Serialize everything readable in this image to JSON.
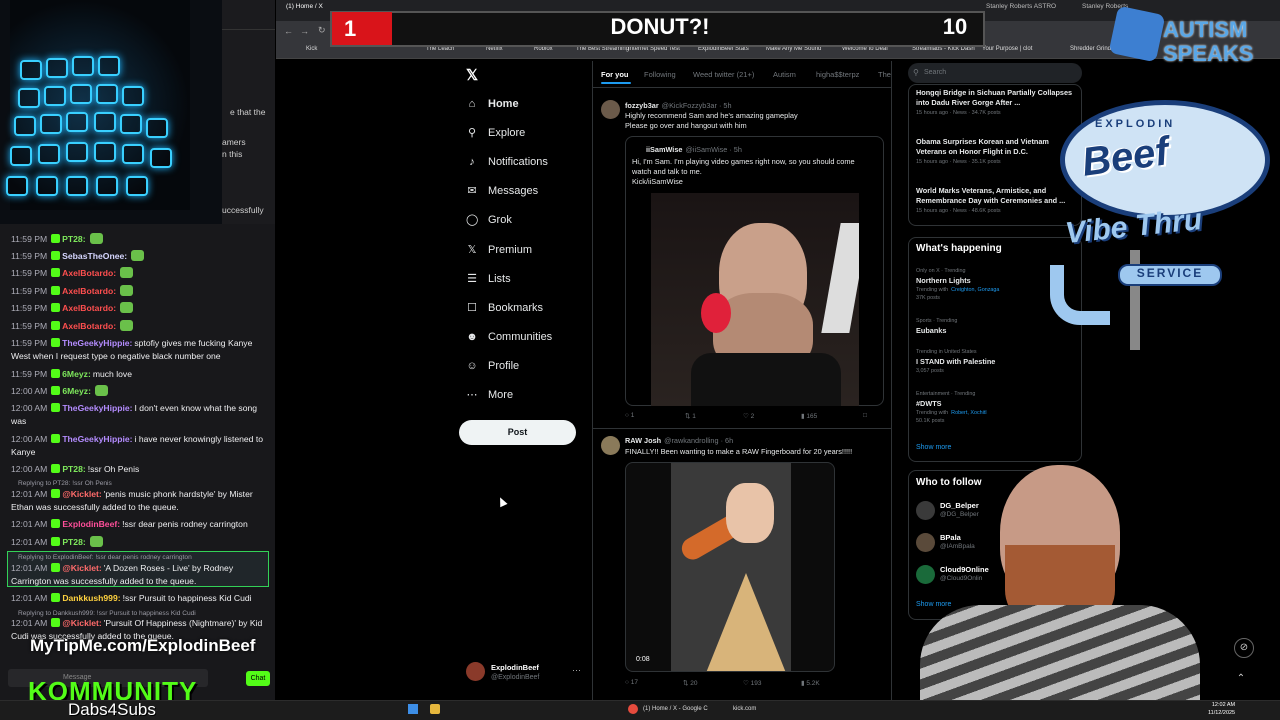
{
  "overlay": {
    "donut_left": "1",
    "donut_title": "DONUT?!",
    "donut_right": "10",
    "autism_line1": "AUTISM",
    "autism_line2": "SPEAKS",
    "beef_top": "EXPLODIN",
    "beef_name": "Beef",
    "vibe": "Vibe Thru",
    "service": "SERVICE",
    "tip_url": "MyTipMe.com/ExplodinBeef",
    "community": "KOMMUNITY",
    "dabs": "Dabs4Subs"
  },
  "chat_top_snippets": [
    "e that the",
    "amers",
    "n this",
    "uccessfully"
  ],
  "chat": [
    {
      "time": "11:59 PM",
      "user": "PT28:",
      "color": "#7ee85c",
      "text": ""
    },
    {
      "time": "11:59 PM",
      "user": "SebasTheOnee:",
      "color": "#d6d6ff",
      "text": ""
    },
    {
      "time": "11:59 PM",
      "user": "AxelBotardo:",
      "color": "#ff4f4f",
      "text": ""
    },
    {
      "time": "11:59 PM",
      "user": "AxelBotardo:",
      "color": "#ff4f4f",
      "text": ""
    },
    {
      "time": "11:59 PM",
      "user": "AxelBotardo:",
      "color": "#ff4f4f",
      "text": ""
    },
    {
      "time": "11:59 PM",
      "user": "AxelBotardo:",
      "color": "#ff4f4f",
      "text": ""
    },
    {
      "time": "11:59 PM",
      "user": "TheGeekyHippie:",
      "color": "#b48cff",
      "text": "sptofiy gives me fucking Kanye West when I request type o negative black number one"
    },
    {
      "time": "11:59 PM",
      "user": "6Meyz:",
      "color": "#7ee85c",
      "text": "much love"
    },
    {
      "time": "12:00 AM",
      "user": "6Meyz:",
      "color": "#7ee85c",
      "text": ""
    },
    {
      "time": "12:00 AM",
      "user": "TheGeekyHippie:",
      "color": "#b48cff",
      "text": "I don't even know what the song was"
    },
    {
      "time": "12:00 AM",
      "user": "TheGeekyHippie:",
      "color": "#b48cff",
      "text": "i have never knowingly listened to Kanye"
    },
    {
      "time": "12:00 AM",
      "user": "PT28:",
      "color": "#7ee85c",
      "text": "!ssr Oh Penis"
    },
    {
      "time": "12:01 AM",
      "user": "@Kicklet:",
      "color": "#ff6b6b",
      "text": "'penis music phonk hardstyle' by Mister Ethan was successfully added to the queue."
    },
    {
      "time": "12:01 AM",
      "user": "ExplodinBeef:",
      "color": "#ff4f9a",
      "text": "!ssr dear penis rodney carrington"
    },
    {
      "time": "12:01 AM",
      "user": "PT28:",
      "color": "#7ee85c",
      "text": ""
    },
    {
      "time": "12:01 AM",
      "user": "@Kicklet:",
      "color": "#ff6b6b",
      "text": "'A Dozen Roses - Live' by Rodney Carrington was successfully added to the queue."
    },
    {
      "time": "12:01 AM",
      "user": "Dankkush999:",
      "color": "#ffd23f",
      "text": "!ssr Pursuit to happiness Kid Cudi"
    },
    {
      "time": "12:01 AM",
      "user": "@Kicklet:",
      "color": "#ff6b6b",
      "text": "'Pursuit Of Happiness (Nightmare)' by Kid Cudi was successfully added to the queue."
    }
  ],
  "replies": [
    "Replying to PT28: !ssr Oh Penis",
    "Replying to ExplodinBeef: !ssr dear penis rodney carrington",
    "Replying to Dankkush999: !ssr Pursuit to happiness Kid Cudi"
  ],
  "chat_input": {
    "placeholder": "Message",
    "send": "Chat"
  },
  "tabs": [
    "(1) Home / X",
    "Kick",
    "Stanley Roberts ASTRO",
    "Stanley Roberts"
  ],
  "bookmarks": [
    "Kick",
    "Twitch",
    "The Leach",
    "Netflix",
    "Roblox",
    "The Best Streaming",
    "Internet Speed Test",
    "ExplodinBeef Stats",
    "Make Any Me Sound",
    "Welcome to Deaf",
    "Streamlabs - Kick Dash",
    "Your Purpose | clot",
    "Shredder Grinder"
  ],
  "x": {
    "nav": [
      "Home",
      "Explore",
      "Notifications",
      "Messages",
      "Grok",
      "Premium",
      "Lists",
      "Bookmarks",
      "Communities",
      "Profile",
      "More"
    ],
    "post_button": "Post",
    "me_name": "ExplodinBeef",
    "me_handle": "@ExplodinBeef",
    "feed_tabs": [
      "For you",
      "Following",
      "Weed twitter (21+)",
      "Autism",
      "higha$$terpz",
      "The"
    ],
    "post1": {
      "name": "fozzyb3ar",
      "handle": "@KickFozzyb3ar · 5h",
      "text1": "Highly recommend Sam and he's amazing gameplay",
      "text2": "Please go over and hangout with him",
      "quote_name": "iiSamWise",
      "quote_handle": "@iiSamWise · 5h",
      "quote_text": "Hi, I'm Sam. I'm playing video games right now, so you should come watch and talk to me.",
      "quote_link": "Kick/iiSamWise",
      "replies": "1",
      "reposts": "1",
      "likes": "2",
      "views": "165"
    },
    "post2": {
      "name": "RAW Josh",
      "handle": "@rawkandrolling · 6h",
      "text": "FINALLY!! Been wanting to make a RAW Fingerboard for 20 years!!!!!",
      "duration": "0:08",
      "replies": "17",
      "reposts": "20",
      "likes": "193",
      "views": "5.2K"
    },
    "search_placeholder": "Search",
    "news": [
      {
        "title": "Hongqi Bridge in Sichuan Partially Collapses into Dadu River Gorge After ...",
        "meta": "15 hours ago · News · 34.7K posts"
      },
      {
        "title": "Obama Surprises Korean and Vietnam Veterans on Honor Flight in D.C.",
        "meta": "15 hours ago · News · 35.1K posts"
      },
      {
        "title": "World Marks Veterans, Armistice, and Remembrance Day with Ceremonies and ...",
        "meta": "15 hours ago · News · 48.6K posts"
      }
    ],
    "whats_happening": "What's happening",
    "trends": [
      {
        "cat": "Only on X · Trending",
        "title": "Northern Lights",
        "extra": "Trending with",
        "with": "Creighton, Gonzaga",
        "posts": "37K posts"
      },
      {
        "cat": "Sports · Trending",
        "title": "Eubanks",
        "extra": "",
        "with": "",
        "posts": ""
      },
      {
        "cat": "Trending in United States",
        "title": "I STAND with Palestine",
        "extra": "",
        "with": "",
        "posts": "3,057 posts"
      },
      {
        "cat": "Entertainment · Trending",
        "title": "#DWTS",
        "extra": "Trending with",
        "with": "Robert, Xochitl",
        "posts": "50.1K posts"
      }
    ],
    "show_more": "Show more",
    "who_to_follow": "Who to follow",
    "follow": [
      {
        "name": "DG_Belper",
        "handle": "@DG_Belper",
        "color": "#3a3a3a"
      },
      {
        "name": "BPala",
        "handle": "@IAmBpala",
        "color": "#5a4a3a"
      },
      {
        "name": "Cloud9Online",
        "handle": "@Cloud9Onlin",
        "color": "#1a6a3a"
      }
    ],
    "show_more2": "Show more"
  },
  "taskbar": {
    "kick": "kick.com",
    "x": "(1) Home / X - Google C",
    "time": "12:02 AM",
    "date": "11/12/2025"
  },
  "colors": {
    "kick_green": "#53fc18",
    "x_blue": "#1d9bf0",
    "donut_red": "#d9141a"
  }
}
